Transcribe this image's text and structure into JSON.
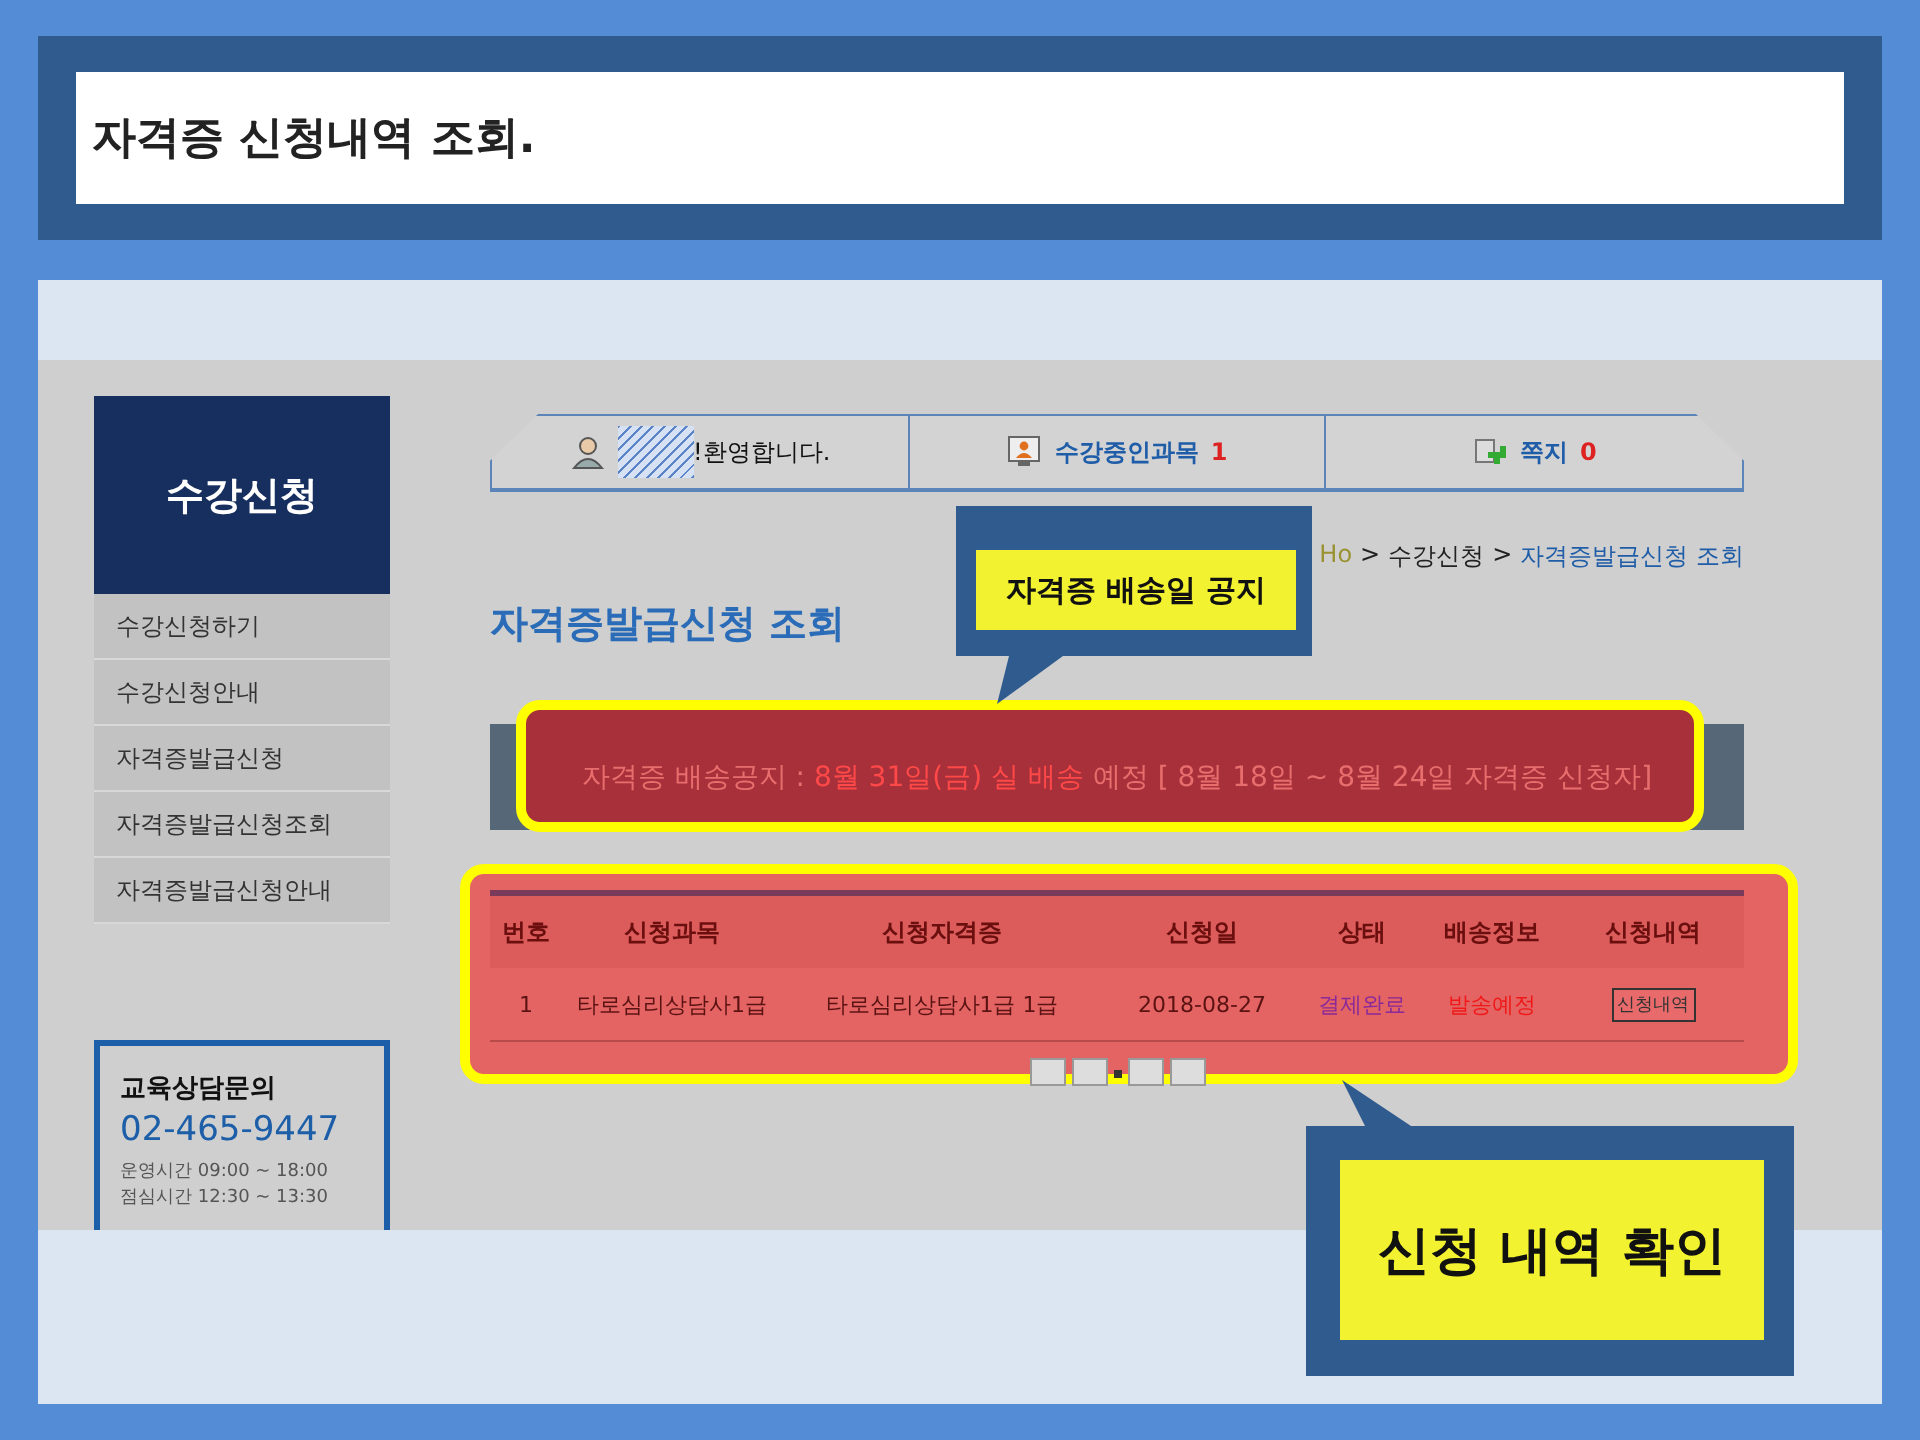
{
  "slide_title": "자격증 신청내역 조회.",
  "sidebar": {
    "title": "수강신청",
    "items": [
      {
        "label": "수강신청하기",
        "selected": false
      },
      {
        "label": "수강신청안내",
        "selected": false
      },
      {
        "label": "자격증발급신청",
        "selected": false
      },
      {
        "label": "자격증발급신청조회",
        "selected": false
      },
      {
        "label": "자격증발급신청안내",
        "selected": false
      }
    ],
    "contact": {
      "title": "교육상담문의",
      "phone": "02-465-9447",
      "hours": [
        "운영시간 09:00 ~ 18:00",
        "점심시간 12:30 ~ 13:30"
      ]
    }
  },
  "top_nav": [
    {
      "kind": "welcome",
      "label": "!환영합니다."
    },
    {
      "kind": "courses",
      "label": "수강중인과목",
      "count": "1"
    },
    {
      "kind": "messages",
      "label": "쪽지",
      "count": "0"
    }
  ],
  "breadcrumb": [
    "Ho",
    ">",
    "수강신청",
    ">",
    "자격증발급신청 조회"
  ],
  "page_title": "자격증발급신청 조회",
  "notice": [
    {
      "text": "자격증 배송공지 : ",
      "highlight": false
    },
    {
      "text": "8월 31일(금) 실 배송",
      "highlight": true
    },
    {
      "text": " 예정 [ 8월 18일 ~ 8월 24일 자격증 신청자]",
      "highlight": false
    }
  ],
  "table": {
    "columns": [
      "번호",
      "신청과목",
      "신청자격증",
      "신청일",
      "상태",
      "배송정보",
      "신청내역"
    ],
    "rows": [
      [
        {
          "kind": "text",
          "text": "1"
        },
        {
          "kind": "text",
          "text": "타로심리상담사1급"
        },
        {
          "kind": "text",
          "text": "타로심리상담사1급 1급"
        },
        {
          "kind": "text",
          "text": "2018-08-27"
        },
        {
          "kind": "status",
          "text": "결제완료"
        },
        {
          "kind": "shipping",
          "text": "발송예정"
        },
        {
          "kind": "button",
          "text": "신청내역"
        }
      ]
    ]
  },
  "callouts": [
    {
      "label": "자격증 배송일 공지"
    },
    {
      "label": "신청 내역 확인"
    }
  ]
}
